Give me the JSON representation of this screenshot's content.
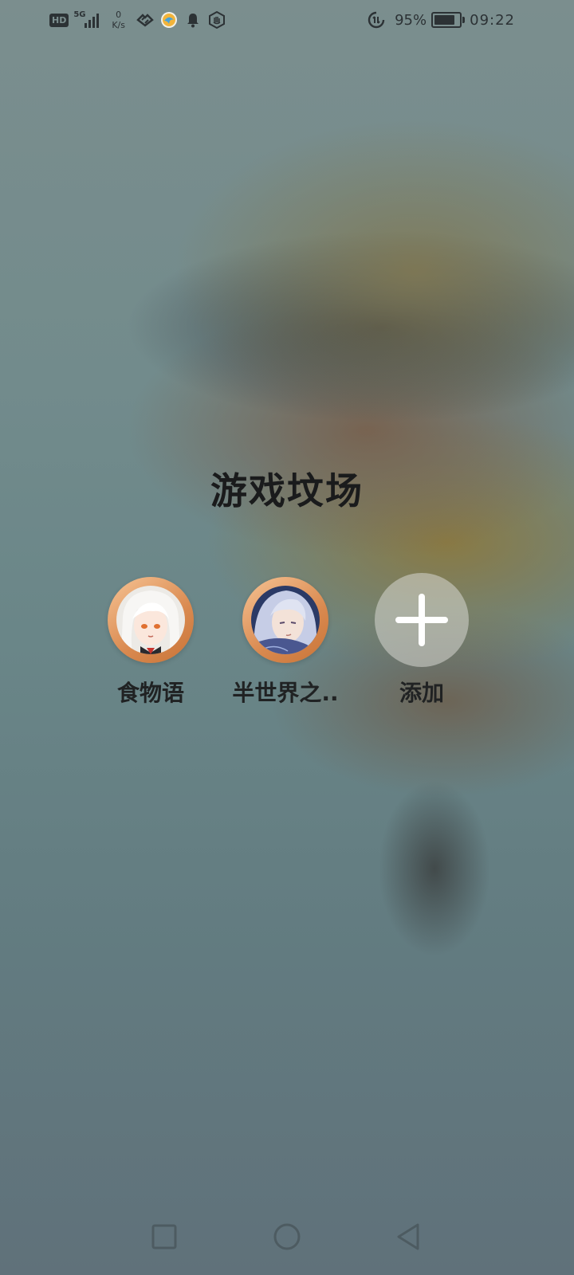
{
  "status_bar": {
    "hd_badge": "HD",
    "network_generation": "5G",
    "net_speed_value": "0",
    "net_speed_unit": "K/s",
    "battery_percent": "95%",
    "battery_level": 0.95,
    "time": "09:22",
    "left_icons": [
      "hd-icon",
      "signal-icon",
      "link-icon",
      "app-notification-icon",
      "bell-icon",
      "hand-icon"
    ],
    "right_icons": [
      "data-saver-icon",
      "battery-icon"
    ]
  },
  "folder": {
    "title": "游戏坟场",
    "apps": [
      {
        "label": "食物语",
        "icon": "food-fantasy-app-icon"
      },
      {
        "label": "半世界之..",
        "icon": "half-world-app-icon"
      }
    ],
    "add_label": "添加"
  },
  "nav_bar": {
    "buttons": [
      "recent-apps-button",
      "home-button",
      "back-button"
    ]
  },
  "colors": {
    "text_dark": "#202223",
    "icon_ring": "#d9894f",
    "add_button_bg": "#d7d7d2"
  }
}
